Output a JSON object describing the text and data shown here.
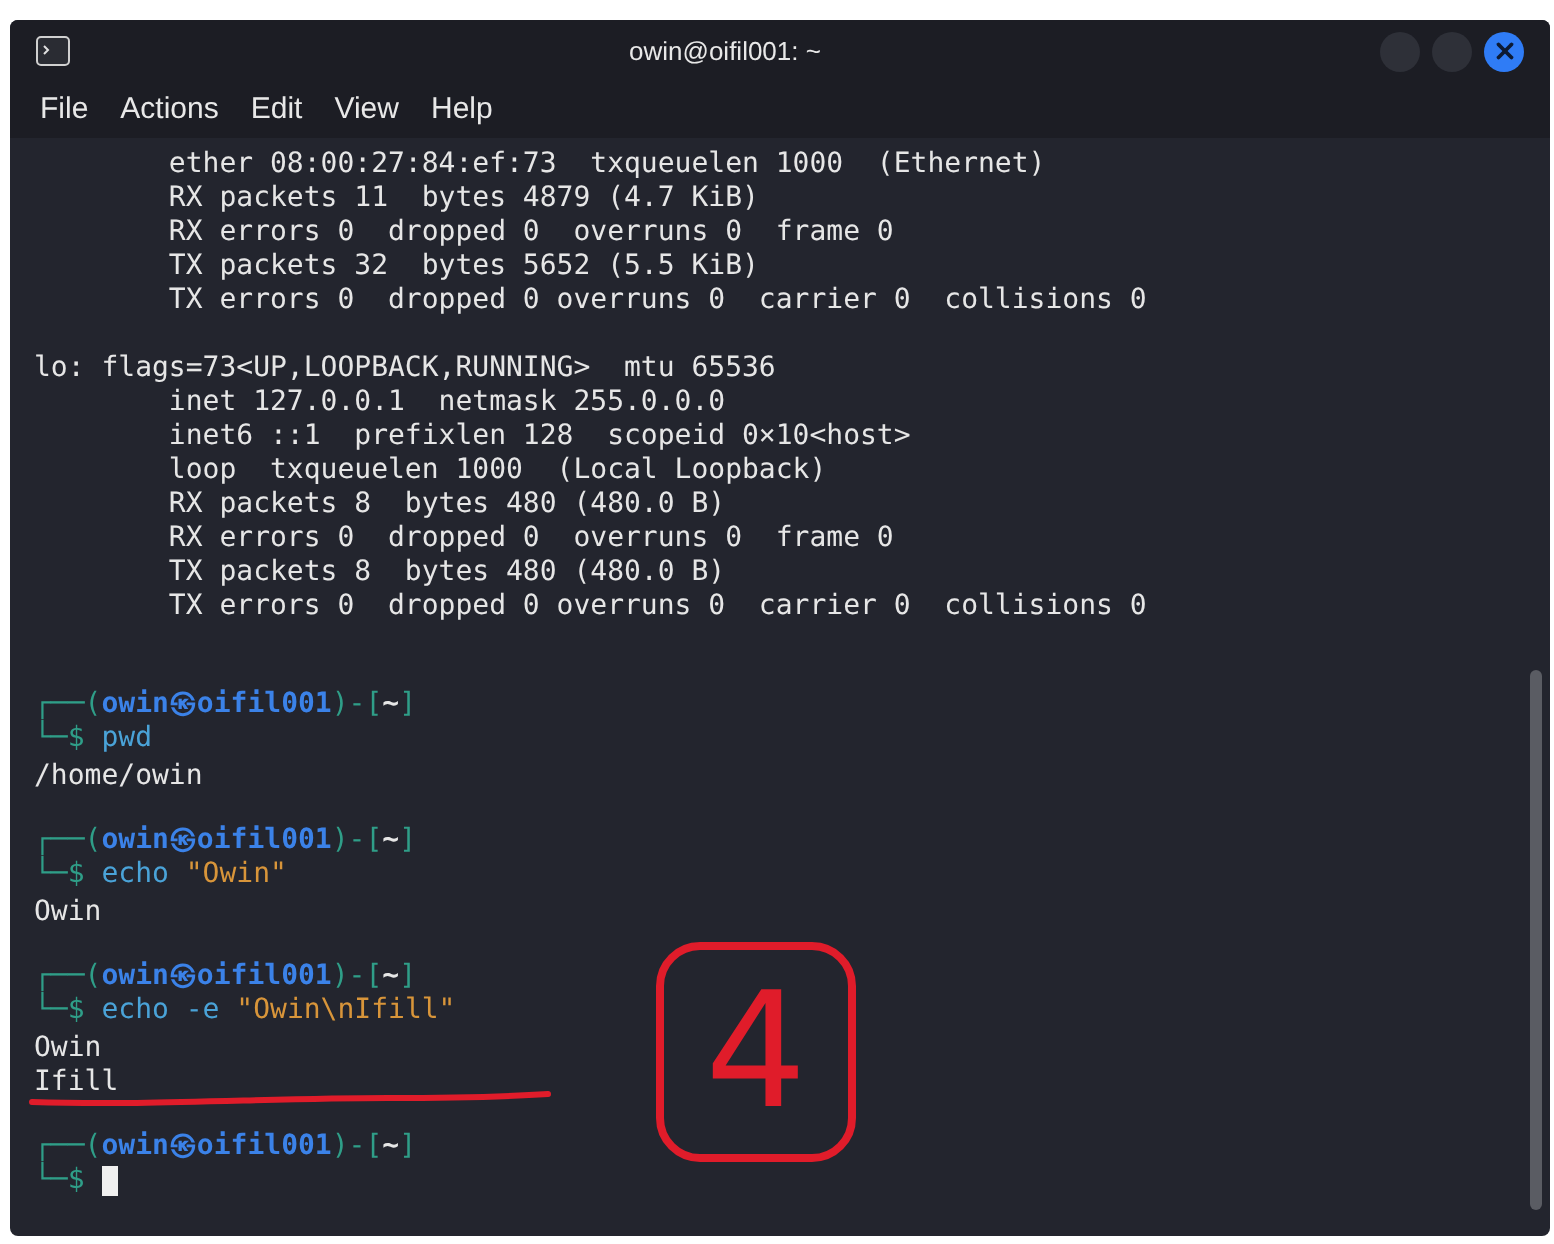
{
  "window": {
    "title": "owin@oifil001: ~"
  },
  "menu": [
    "File",
    "Actions",
    "Edit",
    "View",
    "Help"
  ],
  "terminal": {
    "lines": [
      {
        "kind": "output",
        "text": "        ether 08:00:27:84:ef:73  txqueuelen 1000  (Ethernet)"
      },
      {
        "kind": "output",
        "text": "        RX packets 11  bytes 4879 (4.7 KiB)"
      },
      {
        "kind": "output",
        "text": "        RX errors 0  dropped 0  overruns 0  frame 0"
      },
      {
        "kind": "output",
        "text": "        TX packets 32  bytes 5652 (5.5 KiB)"
      },
      {
        "kind": "output",
        "text": "        TX errors 0  dropped 0 overruns 0  carrier 0  collisions 0"
      },
      {
        "kind": "blank"
      },
      {
        "kind": "output",
        "text": "lo: flags=73<UP,LOOPBACK,RUNNING>  mtu 65536"
      },
      {
        "kind": "output",
        "text": "        inet 127.0.0.1  netmask 255.0.0.0"
      },
      {
        "kind": "output",
        "text": "        inet6 ::1  prefixlen 128  scopeid 0×10<host>"
      },
      {
        "kind": "output",
        "text": "        loop  txqueuelen 1000  (Local Loopback)"
      },
      {
        "kind": "output",
        "text": "        RX packets 8  bytes 480 (480.0 B)"
      },
      {
        "kind": "output",
        "text": "        RX errors 0  dropped 0  overruns 0  frame 0"
      },
      {
        "kind": "output",
        "text": "        TX packets 8  bytes 480 (480.0 B)"
      },
      {
        "kind": "output",
        "text": "        TX errors 0  dropped 0 overruns 0  carrier 0  collisions 0"
      },
      {
        "kind": "blank"
      },
      {
        "kind": "blank"
      },
      {
        "kind": "prompt",
        "segments": [
          {
            "kind": "frame",
            "text": "┌──("
          },
          {
            "kind": "user",
            "text": "owin㉿oifil001"
          },
          {
            "kind": "frame",
            "text": ")-["
          },
          {
            "kind": "dir",
            "text": "~"
          },
          {
            "kind": "frame",
            "text": "]"
          }
        ]
      },
      {
        "kind": "command",
        "segments": [
          {
            "kind": "frame",
            "text": "└─$ "
          },
          {
            "kind": "command",
            "text": "pwd"
          }
        ]
      },
      {
        "kind": "output",
        "text": "/home/owin"
      },
      {
        "kind": "blank"
      },
      {
        "kind": "prompt",
        "segments": [
          {
            "kind": "frame",
            "text": "┌──("
          },
          {
            "kind": "user",
            "text": "owin㉿oifil001"
          },
          {
            "kind": "frame",
            "text": ")-["
          },
          {
            "kind": "dir",
            "text": "~"
          },
          {
            "kind": "frame",
            "text": "]"
          }
        ]
      },
      {
        "kind": "command",
        "segments": [
          {
            "kind": "frame",
            "text": "└─$ "
          },
          {
            "kind": "command",
            "text": "echo "
          },
          {
            "kind": "string",
            "text": "\"Owin\""
          }
        ]
      },
      {
        "kind": "output",
        "text": "Owin"
      },
      {
        "kind": "blank"
      },
      {
        "kind": "prompt",
        "segments": [
          {
            "kind": "frame",
            "text": "┌──("
          },
          {
            "kind": "user",
            "text": "owin㉿oifil001"
          },
          {
            "kind": "frame",
            "text": ")-["
          },
          {
            "kind": "dir",
            "text": "~"
          },
          {
            "kind": "frame",
            "text": "]"
          }
        ]
      },
      {
        "kind": "command",
        "segments": [
          {
            "kind": "frame",
            "text": "└─$ "
          },
          {
            "kind": "command",
            "text": "echo -e "
          },
          {
            "kind": "string",
            "text": "\"Owin\\nIfill\""
          }
        ]
      },
      {
        "kind": "output",
        "text": "Owin"
      },
      {
        "kind": "output",
        "text": "Ifill",
        "underlined": true
      },
      {
        "kind": "blank"
      },
      {
        "kind": "prompt",
        "segments": [
          {
            "kind": "frame",
            "text": "┌──("
          },
          {
            "kind": "user",
            "text": "owin㉿oifil001"
          },
          {
            "kind": "frame",
            "text": ")-["
          },
          {
            "kind": "dir",
            "text": "~"
          },
          {
            "kind": "frame",
            "text": "]"
          }
        ]
      },
      {
        "kind": "command",
        "segments": [
          {
            "kind": "frame",
            "text": "└─$ "
          }
        ],
        "cursor": true
      }
    ]
  },
  "annotation": {
    "label": "4"
  }
}
